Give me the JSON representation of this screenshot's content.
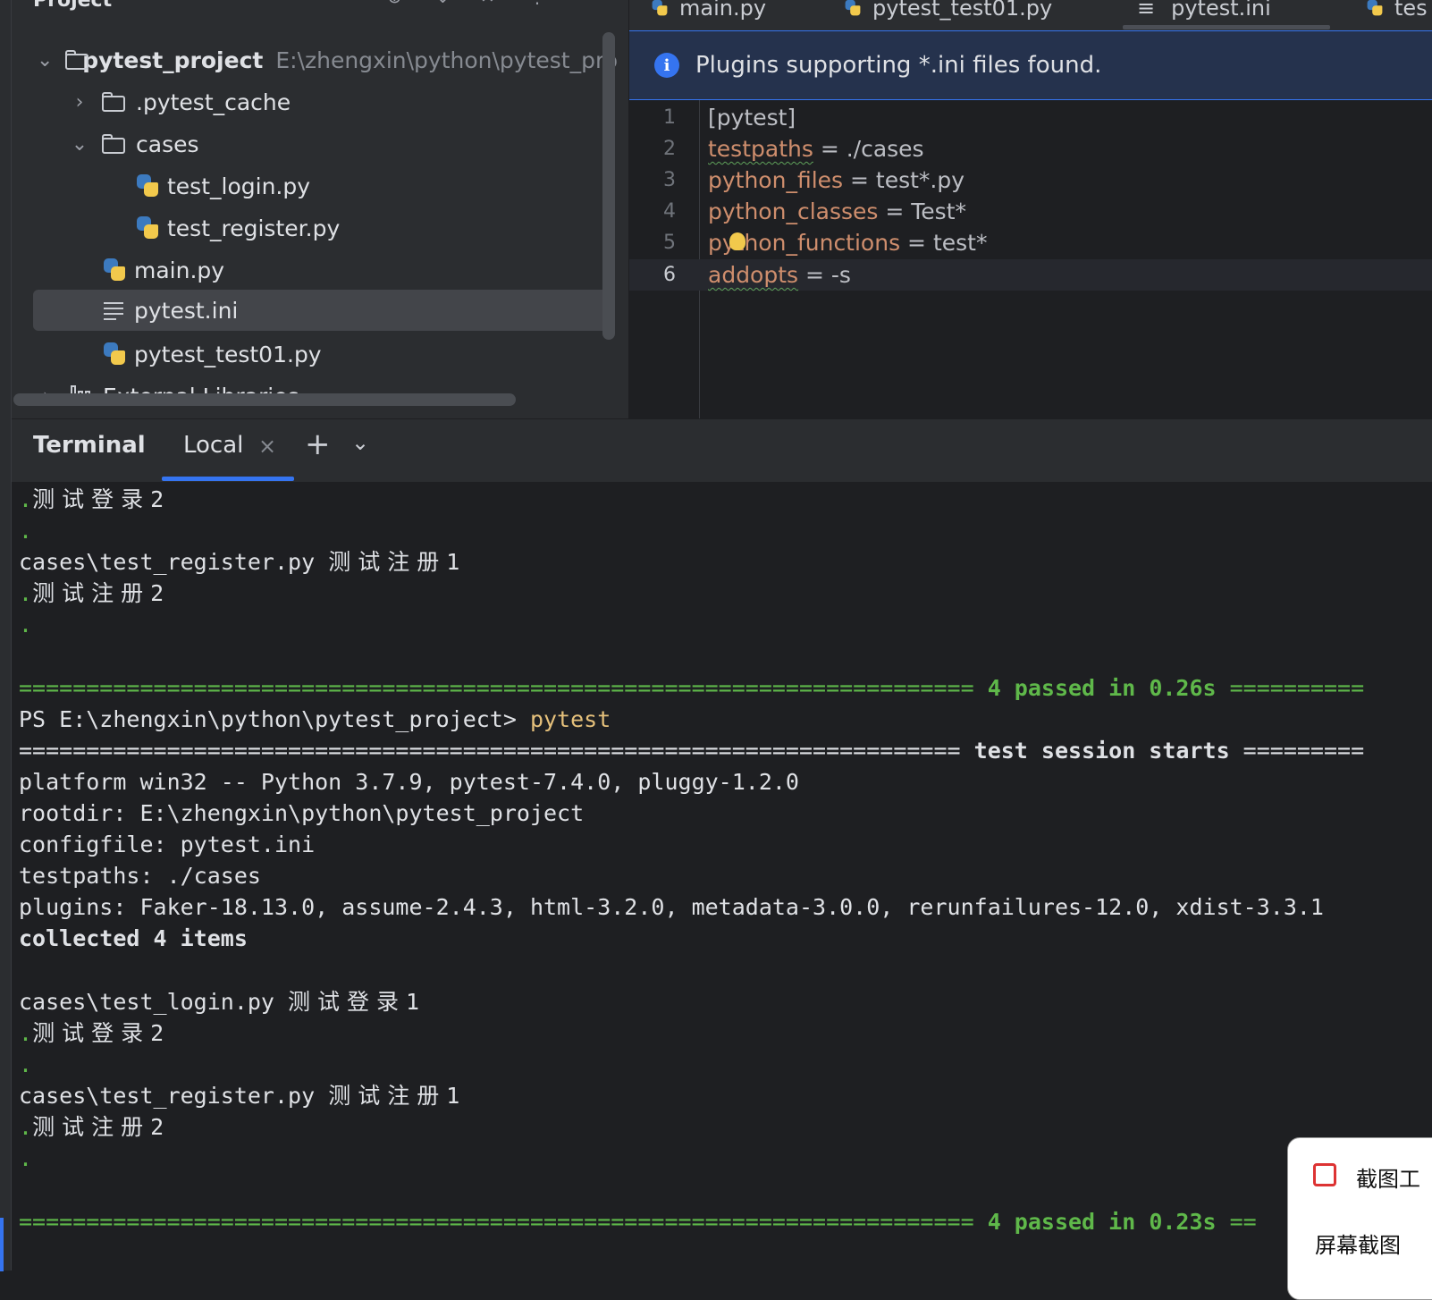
{
  "project_panel": {
    "title": "Project",
    "tree": [
      {
        "label": "pytest_project",
        "hint": "E:\\zhengxin\\python\\pytest_pro",
        "type": "folder",
        "expanded": true,
        "depth": 0
      },
      {
        "label": ".pytest_cache",
        "type": "folder",
        "expanded": false,
        "depth": 1
      },
      {
        "label": "cases",
        "type": "folder",
        "expanded": true,
        "depth": 1
      },
      {
        "label": "test_login.py",
        "type": "python",
        "depth": 2
      },
      {
        "label": "test_register.py",
        "type": "python",
        "depth": 2
      },
      {
        "label": "main.py",
        "type": "python",
        "depth": 1
      },
      {
        "label": "pytest.ini",
        "type": "ini",
        "depth": 1,
        "selected": true
      },
      {
        "label": "pytest_test01.py",
        "type": "python",
        "depth": 1
      },
      {
        "label": "External Libraries",
        "type": "library",
        "expanded": false,
        "depth": 0
      }
    ]
  },
  "editor": {
    "tabs": [
      "main.py",
      "pytest_test01.py",
      "pytest.ini",
      "tes"
    ],
    "banner": "Plugins supporting *.ini files found.",
    "lines": [
      {
        "num": "1",
        "key": "",
        "rest": "[pytest]"
      },
      {
        "num": "2",
        "key": "testpaths",
        "rest": " = ./cases"
      },
      {
        "num": "3",
        "key": "python_files",
        "rest": " = test*.py"
      },
      {
        "num": "4",
        "key": "python_classes",
        "rest": " = Test*"
      },
      {
        "num": "5",
        "key": "python_functions",
        "rest": " = test*"
      },
      {
        "num": "6",
        "key": "addopts",
        "rest": " = -s"
      }
    ]
  },
  "terminal": {
    "title": "Terminal",
    "tab": "Local",
    "lines": {
      "l1_dot": ".",
      "l1_text": "测试登录2",
      "l2": ".",
      "l3_a": "cases\\test_register.py ",
      "l3_b": "测试注册1",
      "l4_dot": ".",
      "l4_text": "测试注册2",
      "l5": ".",
      "l6_eq": "======================================================================= ",
      "l6_res": "4 passed in 0.26s",
      "l6_eq2": " ==========",
      "l7_prompt": "PS E:\\zhengxin\\python\\pytest_project> ",
      "l7_cmd": "pytest",
      "l8_eq": "====================================================================== ",
      "l8_mid": "test session starts",
      "l8_eq2": " =========",
      "l9": "platform win32 -- Python 3.7.9, pytest-7.4.0, pluggy-1.2.0",
      "l10": "rootdir: E:\\zhengxin\\python\\pytest_project",
      "l11": "configfile: pytest.ini",
      "l12": "testpaths: ./cases",
      "l13": "plugins: Faker-18.13.0, assume-2.4.3, html-3.2.0, metadata-3.0.0, rerunfailures-12.0, xdist-3.3.1",
      "l14": "collected 4 items",
      "l15_a": "cases\\test_login.py ",
      "l15_b": "测试登录1",
      "l16_dot": ".",
      "l16_text": "测试登录2",
      "l17": ".",
      "l18_a": "cases\\test_register.py ",
      "l18_b": "测试注册1",
      "l19_dot": ".",
      "l19_text": "测试注册2",
      "l20": ".",
      "l21_eq": "======================================================================= ",
      "l21_res": "4 passed in 0.23s",
      "l21_eq2": " =="
    }
  },
  "popup": {
    "label1": "截图工",
    "label2": "屏幕截图"
  },
  "colors": {
    "accent": "#3574f0",
    "key": "#cf8e6d",
    "pass_green": "#5fb84a",
    "command_yellow": "#e5c07b"
  }
}
